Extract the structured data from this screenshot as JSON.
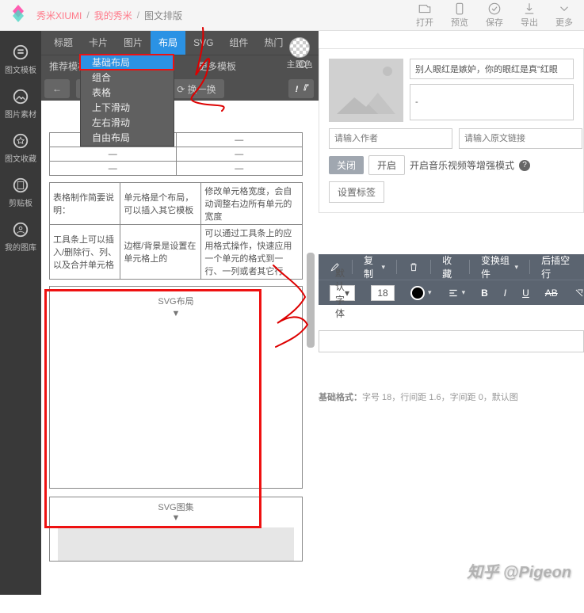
{
  "breadcrumb": {
    "a1": "秀米XIUMI",
    "a2": "我的秀米",
    "current": "图文排版"
  },
  "header_btns": {
    "open": "打开",
    "preview": "预览",
    "save": "保存",
    "export": "导出",
    "more": "更多"
  },
  "iconbar": {
    "i1": "图文模板",
    "i2": "图片素材",
    "i3": "图文收藏",
    "i4": "剪贴板",
    "i5": "我的图库"
  },
  "tabs": {
    "t1": "标题",
    "t2": "卡片",
    "t3": "图片",
    "t4": "布局",
    "t5": "SVG",
    "t6": "组件",
    "t7": "热门"
  },
  "subtabs": {
    "s1": "推荐模板",
    "s2": "更多模板"
  },
  "nav": {
    "prev": "←",
    "next": "→",
    "swap": "⟳ 换一换"
  },
  "theme_color_label": "主题色",
  "dropdown": {
    "d1": "基础布局",
    "d2": "组合",
    "d3": "表格",
    "d4": "上下滑动",
    "d5": "左右滑动",
    "d6": "自由布局"
  },
  "table1": {
    "c1": "—",
    "c2": "—",
    "c3": "—",
    "c4": "—",
    "c5": "—",
    "c6": "—"
  },
  "table2": {
    "r1c1": "表格制作简要说明：",
    "r1c2": "单元格是个布局，可以插入其它模板",
    "r1c3": "修改单元格宽度，会自动调整右边所有单元的宽度",
    "r2c1": "工具条上可以插入/删除行、列、以及合并单元格",
    "r2c2": "边框/背景是设置在单元格上的",
    "r2c3": "可以通过工具条上的应用格式操作，快速应用一个单元的格式到一行、一列或者其它行"
  },
  "svg_layout": {
    "title": "SVG布局",
    "arrow": "▼"
  },
  "svg_album": {
    "title": "SVG图集",
    "arrow": "▼"
  },
  "doc_head": {
    "title_input": "别人眼红是嫉妒，你的眼红是真\"红眼",
    "subtitle_input": "-",
    "author_ph": "请输入作者",
    "link_ph": "请输入原文链接",
    "btn_close": "关闭",
    "btn_open": "开启",
    "enhance_text": "开启音乐视频等增强模式",
    "set_tag": "设置标签"
  },
  "toolbar": {
    "copy": "复制",
    "delete": "🗑",
    "favorite": "收藏",
    "change_comp": "变换组件",
    "insert_after": "后插空行",
    "default_font": "默认字体",
    "font_size": "18",
    "bold": "B",
    "italic": "I",
    "underline": "U",
    "ab": "AB"
  },
  "meta": {
    "prefix": "基础格式：",
    "text": "字号 18，行间距 1.6，字间距 0，默认图"
  },
  "watermark": "知乎 @Pigeon"
}
